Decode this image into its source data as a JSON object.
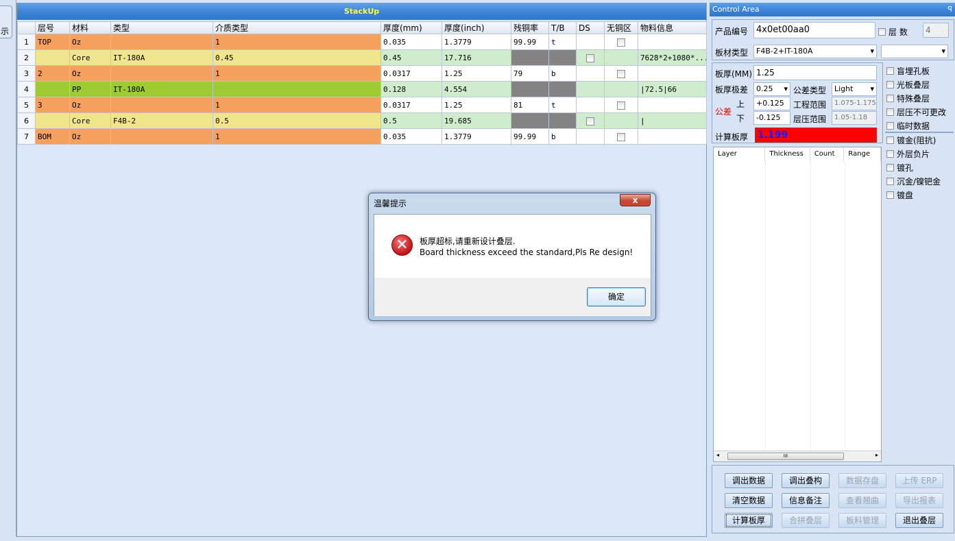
{
  "left_tab": {
    "label": "示"
  },
  "main": {
    "title": "StackUp",
    "columns": [
      "层号",
      "材料",
      "类型",
      "介质类型",
      "厚度(mm)",
      "厚度(inch)",
      "残铜率",
      "T/B",
      "DS",
      "无铜区",
      "物料信息"
    ],
    "rows": [
      {
        "n": "1",
        "layer": "TOP",
        "mat": "Oz",
        "type": "",
        "dielectric": "1",
        "mm": "0.035",
        "inch": "1.3779",
        "copper": "99.99",
        "tb": "t",
        "info": ""
      },
      {
        "n": "2",
        "layer": "",
        "mat": "Core",
        "type": "IT-180A",
        "dielectric": "0.45",
        "mm": "0.45",
        "inch": "17.716",
        "copper": "",
        "tb": "",
        "info": "7628*2+1080*..."
      },
      {
        "n": "3",
        "layer": "2",
        "mat": "Oz",
        "type": "",
        "dielectric": "1",
        "mm": "0.0317",
        "inch": "1.25",
        "copper": "79",
        "tb": "b",
        "info": ""
      },
      {
        "n": "4",
        "layer": "",
        "mat": "PP",
        "type": "IT-180A",
        "dielectric": "",
        "mm": "0.128",
        "inch": "4.554",
        "copper": "",
        "tb": "",
        "info": "|72.5|66"
      },
      {
        "n": "5",
        "layer": "3",
        "mat": "Oz",
        "type": "",
        "dielectric": "1",
        "mm": "0.0317",
        "inch": "1.25",
        "copper": "81",
        "tb": "t",
        "info": ""
      },
      {
        "n": "6",
        "layer": "",
        "mat": "Core",
        "type": "F4B-2",
        "dielectric": "0.5",
        "mm": "0.5",
        "inch": "19.685",
        "copper": "",
        "tb": "",
        "info": "|"
      },
      {
        "n": "7",
        "layer": "BOM",
        "mat": "Oz",
        "type": "",
        "dielectric": "1",
        "mm": "0.035",
        "inch": "1.3779",
        "copper": "99.99",
        "tb": "b",
        "info": ""
      }
    ]
  },
  "control": {
    "title": "Control Area",
    "pin": "ꟼ",
    "product_label": "产品编号",
    "product_value": "4x0et00aa0",
    "layers_label": "层 数",
    "layers_value": "4",
    "material_label": "板材类型",
    "material_value": "F4B-2+IT-180A",
    "material_extra": "",
    "thickness_label": "板厚(MM)",
    "thickness_value": "1.25",
    "tolerance_label": "板厚极差",
    "tolerance_value": "0.25",
    "tol_type_label": "公差类型",
    "tol_type_value": "Light",
    "gongcha_label": "公差",
    "upper_label": "上",
    "upper_value": "+0.125",
    "lower_label": "下",
    "lower_value": "-0.125",
    "eng_range_label": "工程范围",
    "eng_range_value": "1.075-1.175",
    "press_range_label": "层压范围",
    "press_range_value": "1.05-1.18",
    "calc_label": "计算板厚",
    "calc_value": "1.199",
    "calc_color": "#ff0000",
    "list_headers": [
      "Layer",
      "Thickness",
      "Count",
      "Range"
    ],
    "scroll_grip": "III",
    "options1": [
      "盲埋孔板",
      "光板叠层",
      "特殊叠层",
      "层压不可更改",
      "临时数据"
    ],
    "options2": [
      "镀金(阻抗)",
      "外层负片",
      "镀孔",
      "沉金/镍钯金",
      "镀盘"
    ],
    "buttons": [
      {
        "label": "调出数据",
        "enabled": true
      },
      {
        "label": "调出叠构",
        "enabled": true
      },
      {
        "label": "数据存盘",
        "enabled": false
      },
      {
        "label": "上传 ERP",
        "enabled": false
      },
      {
        "label": "清空数据",
        "enabled": true
      },
      {
        "label": "信息备注",
        "enabled": true
      },
      {
        "label": "查看翘曲",
        "enabled": false
      },
      {
        "label": "导出报表",
        "enabled": false
      },
      {
        "label": "计算板厚",
        "enabled": true
      },
      {
        "label": "合拼叠层",
        "enabled": false
      },
      {
        "label": "板料管理",
        "enabled": false
      },
      {
        "label": "退出叠层",
        "enabled": true
      }
    ]
  },
  "dialog": {
    "title": "温馨提示",
    "close": "x",
    "message_cn": "板厚超标,请重新设计叠层.",
    "message_en": "Board thickness exceed the standard,Pls Re design!",
    "ok": "确定",
    "error_glyph": "✕"
  }
}
